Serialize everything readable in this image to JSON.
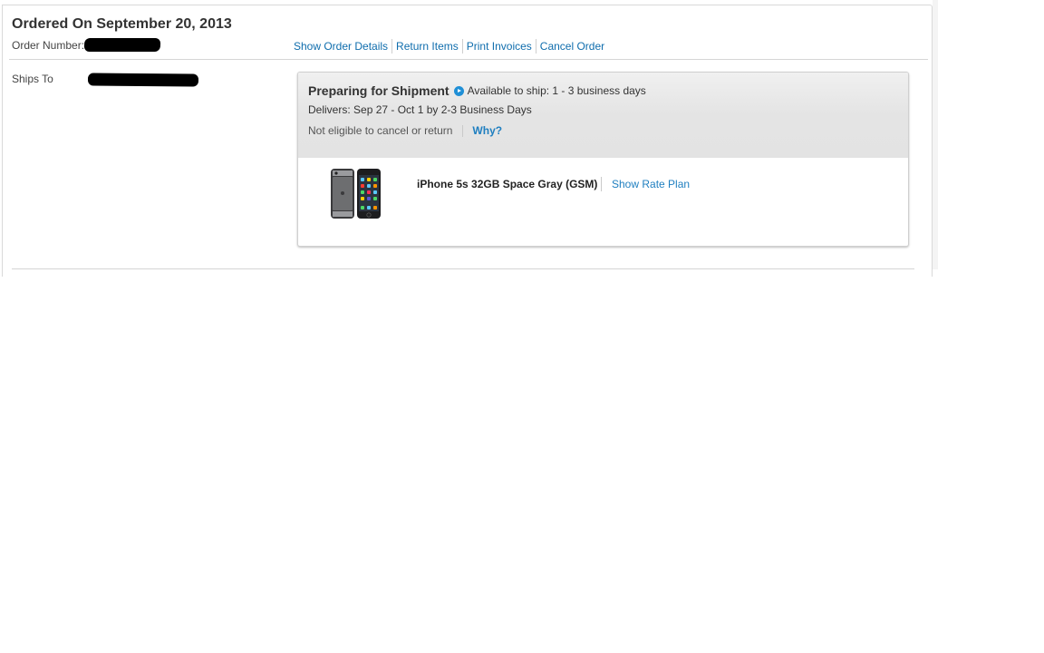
{
  "order": {
    "title": "Ordered On September 20, 2013",
    "order_number_label": "Order Number:",
    "ships_to_label": "Ships To",
    "actions": {
      "show_details": "Show Order Details",
      "return_items": "Return Items",
      "print_invoices": "Print Invoices",
      "cancel_order": "Cancel Order"
    }
  },
  "shipment": {
    "status": "Preparing for Shipment",
    "availability": "Available to ship: 1 - 3 business days",
    "delivers": "Delivers: Sep 27 - Oct 1 by 2-3 Business Days",
    "eligibility_note": "Not eligible to cancel or return",
    "why_link": "Why?",
    "status_icon": "play-circle-icon",
    "accent_color": "#1f8fd6"
  },
  "product": {
    "name": "iPhone 5s 32GB Space Gray (GSM)",
    "rate_plan_link": "Show Rate Plan",
    "image_icon": "iphone-product-image"
  }
}
